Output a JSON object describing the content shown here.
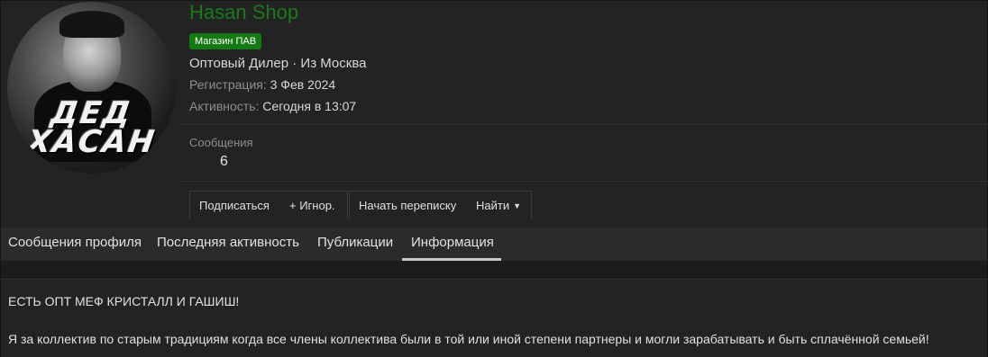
{
  "profile": {
    "avatar_text_line1": "ДЕД",
    "avatar_text_line2": "ХАСАН",
    "username": "Hasan Shop",
    "banner": "Магазин ПАВ",
    "user_title": "Оптовый Дилер · Из Москва",
    "registration_label": "Регистрация:",
    "registration_value": "3 Фев 2024",
    "activity_label": "Активность:",
    "activity_value": "Сегодня в 13:07",
    "stats": {
      "messages_label": "Сообщения",
      "messages_value": "6"
    },
    "colors": {
      "username": "#1a7a1a",
      "banner_bg": "#137a13"
    }
  },
  "buttons": {
    "subscribe": "Подписаться",
    "ignore": "+ Игнор.",
    "start_conversation": "Начать переписку",
    "find": "Найти",
    "find_icon": "caret-down-icon"
  },
  "tabs": [
    {
      "label": "Сообщения профиля",
      "active": false
    },
    {
      "label": "Последняя активность",
      "active": false
    },
    {
      "label": "Публикации",
      "active": false
    },
    {
      "label": "Информация",
      "active": true
    }
  ],
  "about": {
    "line1": "ЕСТЬ ОПТ МЕФ КРИСТАЛЛ И ГАШИШ!",
    "line2": "Я за коллектив по старым традициям когда все члены коллектива были в той или иной степени партнеры и могли зарабатывать и быть сплачённой семьей!"
  }
}
